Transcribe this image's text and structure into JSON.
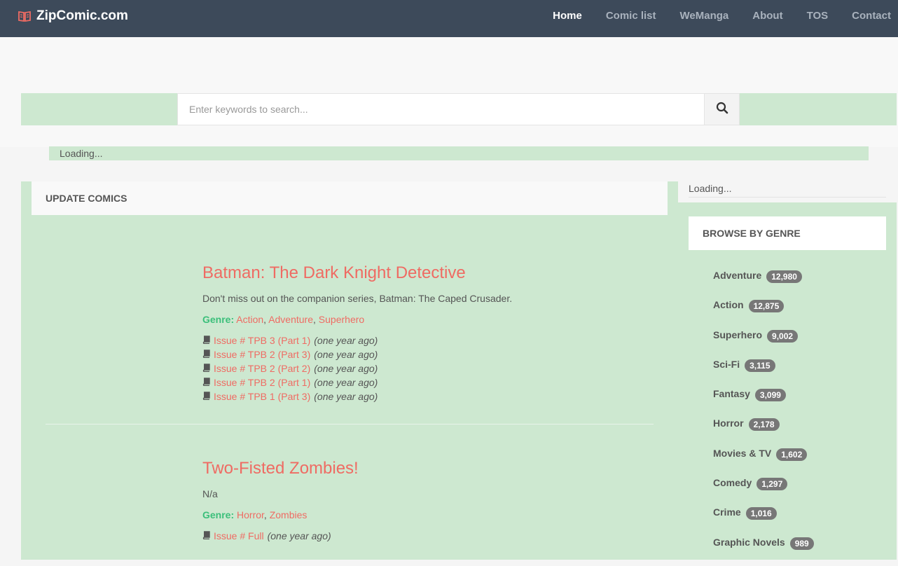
{
  "nav": {
    "brand": "ZipComic.com",
    "links": [
      "Home",
      "Comic list",
      "WeManga",
      "About",
      "TOS",
      "Contact"
    ]
  },
  "search": {
    "placeholder": "Enter keywords to search..."
  },
  "loading_text": "Loading...",
  "update_section": {
    "title": "UPDATE COMICS"
  },
  "comics": [
    {
      "title": "Batman: The Dark Knight Detective",
      "description": "Don't miss out on the companion series, Batman: The Caped Crusader.",
      "genre_label": "Genre:",
      "genres": [
        "Action",
        "Adventure",
        "Superhero"
      ],
      "issues": [
        {
          "label": "Issue # TPB 3 (Part 1)",
          "time": "(one year ago)"
        },
        {
          "label": "Issue # TPB 2 (Part 3)",
          "time": "(one year ago)"
        },
        {
          "label": "Issue # TPB 2 (Part 2)",
          "time": "(one year ago)"
        },
        {
          "label": "Issue # TPB 2 (Part 1)",
          "time": "(one year ago)"
        },
        {
          "label": "Issue # TPB 1 (Part 3)",
          "time": "(one year ago)"
        }
      ]
    },
    {
      "title": "Two-Fisted Zombies!",
      "description": "N/a",
      "genre_label": "Genre:",
      "genres": [
        "Horror",
        "Zombies"
      ],
      "issues": [
        {
          "label": "Issue # Full",
          "time": "(one year ago)"
        }
      ]
    }
  ],
  "sidebar": {
    "loading_text": "Loading...",
    "genre_title": "BROWSE BY GENRE",
    "genres": [
      {
        "name": "Adventure",
        "count": "12,980"
      },
      {
        "name": "Action",
        "count": "12,875"
      },
      {
        "name": "Superhero",
        "count": "9,002"
      },
      {
        "name": "Sci-Fi",
        "count": "3,115"
      },
      {
        "name": "Fantasy",
        "count": "3,099"
      },
      {
        "name": "Horror",
        "count": "2,178"
      },
      {
        "name": "Movies & TV",
        "count": "1,602"
      },
      {
        "name": "Comedy",
        "count": "1,297"
      },
      {
        "name": "Crime",
        "count": "1,016"
      },
      {
        "name": "Graphic Novels",
        "count": "989"
      }
    ]
  },
  "colors": {
    "navbar": "#3d4a5a",
    "accent": "#ef6b63",
    "genre_label": "#3bbf7a",
    "panel_bg": "#cde8d0"
  }
}
